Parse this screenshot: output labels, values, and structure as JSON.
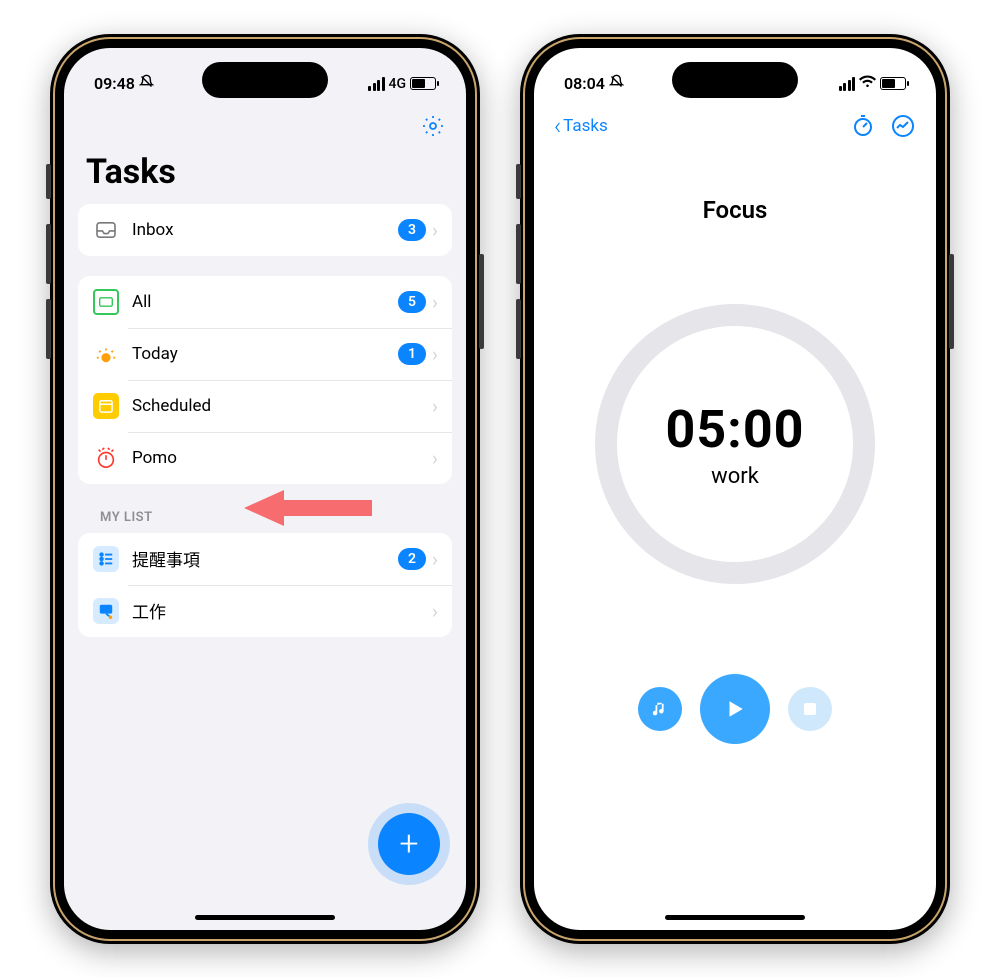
{
  "left": {
    "status": {
      "time": "09:48",
      "network": "4G"
    },
    "title": "Tasks",
    "inbox": {
      "label": "Inbox",
      "count": "3"
    },
    "smart": [
      {
        "label": "All",
        "count": "5"
      },
      {
        "label": "Today",
        "count": "1"
      },
      {
        "label": "Scheduled",
        "count": null
      },
      {
        "label": "Pomo",
        "count": null
      }
    ],
    "section_header": "MY LIST",
    "lists": [
      {
        "label": "提醒事項",
        "count": "2"
      },
      {
        "label": "工作",
        "count": null
      }
    ]
  },
  "right": {
    "status": {
      "time": "08:04"
    },
    "back_label": "Tasks",
    "focus_title": "Focus",
    "timer_time": "05:00",
    "timer_label": "work"
  },
  "colors": {
    "accent": "#0a84ff",
    "annotation": "#f66c6f"
  }
}
